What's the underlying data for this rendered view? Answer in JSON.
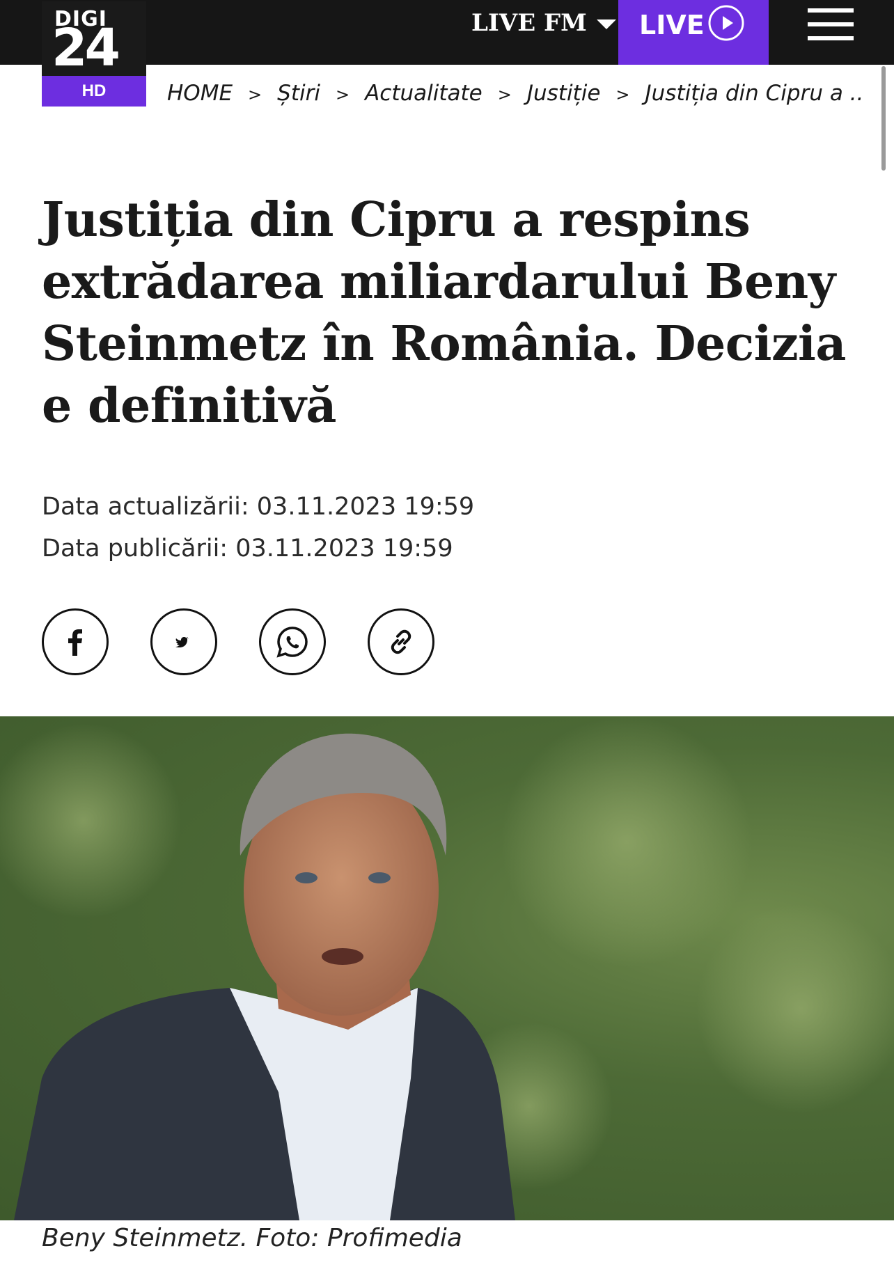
{
  "header": {
    "logo_top": "DIGI",
    "logo_number": "24",
    "logo_badge": "HD",
    "live_fm_label": "LIVE FM",
    "live_label": "LIVE"
  },
  "breadcrumb": {
    "items": [
      "HOME",
      "Știri",
      "Actualitate",
      "Justiție",
      "Justiția din Cipru a ..."
    ],
    "separator": ">"
  },
  "article": {
    "title": "Justiția din Cipru a respins extrădarea miliardarului Beny Steinmetz în România. Decizia e definitivă",
    "updated_label": "Data actualizării:",
    "updated_value": "03.11.2023 19:59",
    "published_label": "Data publicării:",
    "published_value": "03.11.2023 19:59",
    "photo_caption": "Beny Steinmetz. Foto: Profimedia"
  },
  "share": {
    "icons": [
      "facebook-icon",
      "twitter-icon",
      "whatsapp-icon",
      "link-icon"
    ]
  },
  "colors": {
    "topbar": "#161616",
    "accent": "#6d2ee0",
    "text": "#1a1a1a"
  }
}
